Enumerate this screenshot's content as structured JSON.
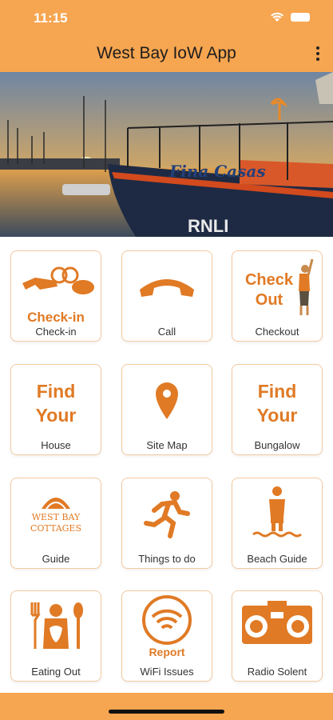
{
  "status": {
    "time": "11:15"
  },
  "header": {
    "title": "West Bay IoW App"
  },
  "banner": {
    "brand": "Fina Casas"
  },
  "colors": {
    "accent": "#f6a550",
    "icon": "#e07a25",
    "tile_border": "#f3c9a0"
  },
  "tiles": [
    {
      "label": "Check-in",
      "icon_text": "Check-in",
      "icon": "keys-icon"
    },
    {
      "label": "Call",
      "icon": "phone-icon"
    },
    {
      "label": "Checkout",
      "icon_text": [
        "Check",
        "Out"
      ],
      "icon": "person-waving-icon"
    },
    {
      "label": "House",
      "icon_text": [
        "Find",
        "Your"
      ],
      "icon": "find-text-icon"
    },
    {
      "label": "Site Map",
      "icon": "map-pin-icon"
    },
    {
      "label": "Bungalow",
      "icon_text": [
        "Find",
        "Your"
      ],
      "icon": "find-text-icon"
    },
    {
      "label": "Guide",
      "icon_text": [
        "WEST BAY",
        "COTTAGES"
      ],
      "icon": "shell-logo-icon"
    },
    {
      "label": "Things to do",
      "icon": "running-person-icon"
    },
    {
      "label": "Beach Guide",
      "icon": "beach-person-icon"
    },
    {
      "label": "Eating Out",
      "icon": "fork-spoon-icon"
    },
    {
      "label": "WiFi Issues",
      "icon_text": "Report",
      "icon": "wifi-icon"
    },
    {
      "label": "Radio Solent",
      "icon": "radio-icon"
    }
  ]
}
